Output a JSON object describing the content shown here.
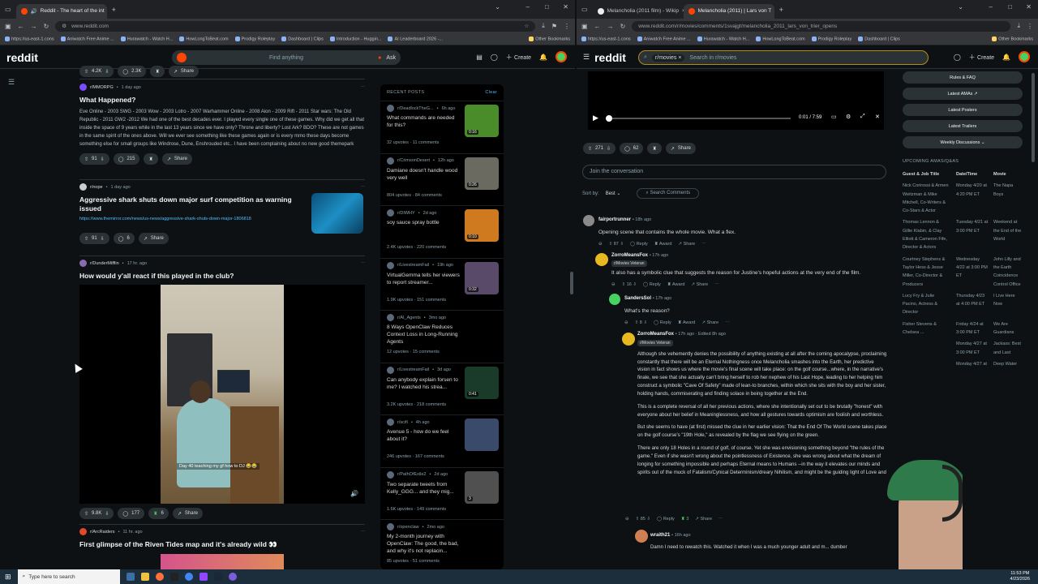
{
  "left_browser": {
    "tabs": [
      {
        "label": "Reddit - The heart of the int"
      }
    ],
    "url": "www.reddit.com",
    "bookmarks": [
      "https://us-east-1.cons",
      "Aniwatch Free Anime ...",
      "Hurawatch - Watch H...",
      "HowLongToBeat.com",
      "Prodigy Roleplay",
      "Dashboard | Clips",
      "Introduction - Huggin...",
      "AI Leaderboard 2026 -...",
      "Other Bookmarks"
    ],
    "header": {
      "logo": "reddit",
      "search_placeholder": "Find anything",
      "ask": "Ask",
      "create": "Create"
    },
    "top_strip": {
      "votes": "4.2K",
      "comments": "2.3K",
      "share": "Share"
    },
    "posts": [
      {
        "sub": "r/MMORPG",
        "time": "1 day ago",
        "title": "What Happened?",
        "body": "Eve Online - 2003 SWG - 2003 Wow - 2003 Lotro - 2007 Warhammer Online - 2008 Aion - 2009 Rift - 2011 Star wars: The Old Republic - 2011 GW2 -2012 We had one of the best decades ever. I played every single one of these games. Why did we get all that inside the space of 9 years while in the last 13 years since we have only? Throne and liberty? Lost Ark? BDO? These are not games in the same spirit of the ones above. Will we ever see something like these games again or is every mmo these days become something else for small groups like Windrose, Dune, Enshrouded etc.. I have been complaining about no new good themepark mmos since 2015. i...",
        "votes": "91",
        "comments": "215",
        "share": "Share"
      },
      {
        "sub": "r/nope",
        "time": "1 day ago",
        "title": "Aggressive shark shuts down major surf competition as warning issued",
        "link": "https://www.themirror.com/news/us-news/aggressive-shark-shuts-down-major-1806818",
        "votes": "91",
        "comments": "6",
        "share": "Share"
      },
      {
        "sub": "r/DunderMifflin",
        "time": "17 hr. ago",
        "title": "How would y'all react if this played in the club?",
        "caption": "Day 40 teaching my gf how to DJ 😂😂",
        "votes": "9.8K",
        "comments": "177",
        "awards": "6",
        "share": "Share"
      },
      {
        "sub": "r/ArcRaiders",
        "time": "11 hr. ago",
        "title": "First glimpse of the Riven Tides map and it's already wild 👀"
      }
    ],
    "recent": {
      "heading": "RECENT POSTS",
      "clear": "Clear",
      "items": [
        {
          "sub": "r/DeadlockTheG...",
          "time": "6h ago",
          "title": "What commands are needed for this?",
          "upvotes": "32 upvotes",
          "comments": "11 comments",
          "dur": "0:16",
          "color": "#4a8c2a"
        },
        {
          "sub": "r/CrimsonDesert",
          "time": "12h ago",
          "title": "Damiane doesn't handle wood very well",
          "upvotes": "804 upvotes",
          "comments": "84 comments",
          "dur": "0:26",
          "color": "#6a6a60"
        },
        {
          "sub": "r/DIWHY",
          "time": "2d ago",
          "title": "soy sauce spray bottle",
          "upvotes": "2.4K upvotes",
          "comments": "220 comments",
          "dur": "0:10",
          "color": "#d07a20"
        },
        {
          "sub": "r/LivestreamFail",
          "time": "19h ago",
          "title": "VirtualGemma tells her viewers to report streamer...",
          "upvotes": "1.9K upvotes",
          "comments": "151 comments",
          "dur": "0:32",
          "color": "#5a4a6a"
        },
        {
          "sub": "r/AI_Agents",
          "time": "3mo ago",
          "title": "8 Ways OpenClaw Reduces Context Loss in Long-Running Agents",
          "upvotes": "12 upvotes",
          "comments": "15 comments",
          "dur": "",
          "color": ""
        },
        {
          "sub": "r/LivestreamFail",
          "time": "3d ago",
          "title": "Can anybody explain forsen to me? I watched his strea...",
          "upvotes": "3.2K upvotes",
          "comments": "218 comments",
          "dur": "0:41",
          "color": "#1a3a2a"
        },
        {
          "sub": "r/scifi",
          "time": "4h ago",
          "title": "Avenue 5 - how do we feel about it?",
          "upvotes": "246 upvotes",
          "comments": "167 comments",
          "dur": "",
          "color": "#3a4a6a"
        },
        {
          "sub": "r/PathOfExile2",
          "time": "2d ago",
          "title": "Two separate tweets from Kelly_GGG... and they mig...",
          "upvotes": "1.6K upvotes",
          "comments": "149 comments",
          "dur": "3",
          "color": "#505050"
        },
        {
          "sub": "r/openclaw",
          "time": "2mo ago",
          "title": "My 2-month journey with OpenClaw: The good, the bad, and why it's not replacin...",
          "upvotes": "85 upvotes",
          "comments": "51 comments",
          "dur": "",
          "color": ""
        }
      ]
    }
  },
  "right_browser": {
    "tabs": [
      {
        "label": "Melancholia (2011 film) - Wikip"
      },
      {
        "label": "Melancholia (2011) | Lars von T"
      }
    ],
    "url": "www.reddit.com/r/movies/comments/1svajgt/melancholia_2011_lars_von_trier_opens",
    "bookmarks": [
      "https://us-east-1.cons",
      "Aniwatch Free Anime ...",
      "Hurawatch - Watch H...",
      "HowLongToBeat.com",
      "Prodigy Roleplay",
      "Dashboard | Clips",
      "Other Bookmarks"
    ],
    "header": {
      "logo": "reddit",
      "chip": "r/movies",
      "search_placeholder": "Search in r/movies",
      "create": "Create"
    },
    "player": {
      "time": "0:01 / 7:59"
    },
    "post_actions": {
      "votes": "271",
      "comments": "62",
      "share": "Share"
    },
    "join": "Join the conversation",
    "sort": {
      "label": "Sort by:",
      "value": "Best",
      "search": "Search Comments"
    },
    "comments": [
      {
        "user": "fairportrunner",
        "time": "18h ago",
        "text": "Opening scene that contains the whole movie. What a flex.",
        "votes": "87",
        "reply": "Reply",
        "award": "Award",
        "share": "Share"
      },
      {
        "user": "ZorroMeansFox",
        "time": "17h ago",
        "flair": "r/Movies Veteran",
        "text": "It also has a symbolic clue that suggests the reason for Justine's hopeful actions at the very end of the film.",
        "votes": "16",
        "reply": "Reply",
        "award": "Award",
        "share": "Share"
      },
      {
        "user": "SandersSol",
        "time": "17h ago",
        "text": "What's the reason?",
        "votes": "8",
        "reply": "Reply",
        "award": "Award",
        "share": "Share"
      },
      {
        "user": "ZorroMeansFox",
        "time": "17h ago · Edited 8h ago",
        "flair": "r/Movies Veteran",
        "paras": [
          "Although she vehemently denies the possibility of anything existing at all after the coming apocalypse, proclaiming constantly that there will be an Eternal Nothingness once Melancholia smashes into the Earth, her predictive vision in fact shows us where the movie's final scene will take place: on the golf course...where, in the narrative's finale, we see that she actually can't bring herself to rob her nephew of his Last Hope, leading to her helping him construct a symbolic \"Cave Of Safety\" made of lean-to branches, within which she sits with the boy and her sister, holding hands, commiserating and finding solace in being together at the End.",
          "This is a complete reversal of all her previous actions, where she intentionally set out to be brutally \"honest\" with everyone about her belief in Meaninglessness, and how all gestures towards optimism are foolish and worthless.",
          "But she seems to have (at first) missed the clue in her earlier vision: That the End Of The World scene takes place on the golf course's \"19th Hole,\" as revealed by the flag we see flying on the green.",
          "There are only 18 Holes in a round of golf, of course. Yet she was envisioning something beyond \"the rules of the game.\" Even if she wasn't wrong about the pointlessness of Existence, she was wrong about what the dream of longing for something impossible and perhaps Eternal means to Humans --in the way it elevates our minds and spirits out of the muck of Fatalism/Cynical Determinism/dreary Nihilism, and might be the guiding light of Love and Art."
        ],
        "votes": "85",
        "awards": "3",
        "reply": "Reply",
        "share": "Share"
      },
      {
        "user": "wraith21",
        "time": "16h ago",
        "text": "Damn I need to rewatch this. Watched it when I was a much younger adult and m... dumber"
      }
    ],
    "sidebar": {
      "buttons": [
        "Rules & FAQ",
        "Latest AMAs ↗",
        "Latest Posters",
        "Latest Trailers",
        "Weekly Discussions"
      ],
      "ama_heading": "UPCOMING AMAS/Q&AS",
      "cols": [
        "Guest & Job Title",
        "Date/Time",
        "Movie"
      ],
      "rows": [
        [
          "Nick Corirossi & Armen Weitzman & Mike Mitchell, Co-Writers & Co-Stars & Actor",
          "Monday 4/20 at 4:20 PM ET",
          "The Napa Boys"
        ],
        [
          "Thomas Lennon & Gillie Klabin, & Clay Elliott & Cameron Fife, Director & Actors",
          "Tuesday 4/21 at 3:00 PM ET",
          "Weekend at the End of the World"
        ],
        [
          "Courtney Stephens & Taylor Hess & Jesse Miller, Co-Director & Producers",
          "Wednesday 4/22 at 3:00 PM ET",
          "John Lilly and the Earth Coincidence Control Office"
        ],
        [
          "Lucy Fry & Julie Pacino, Actress & Director",
          "Thursday 4/23 at 4:00 PM ET",
          "I Live Here Now"
        ],
        [
          "Fisher Stevens & Chelsea ...",
          "Friday 4/24 at 3:00 PM ET",
          "We Are Guardians"
        ],
        [
          "",
          "Monday 4/27 at 3:00 PM ET",
          "Jackass: Best and Last"
        ],
        [
          "",
          "Monday 4/27 at",
          "Deep Water"
        ]
      ]
    }
  },
  "taskbar": {
    "search": "Type here to search",
    "time": "11:53 PM",
    "date": "4/23/2026"
  }
}
